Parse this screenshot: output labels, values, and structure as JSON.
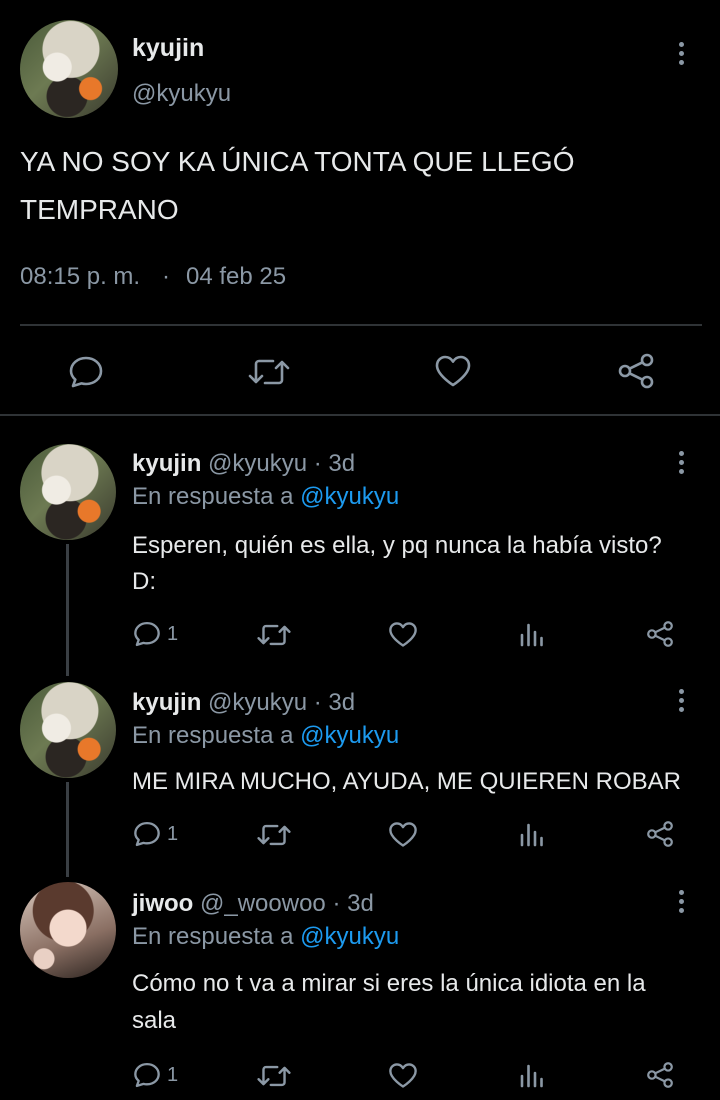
{
  "main_tweet": {
    "name": "kyujin",
    "handle": "@kyukyu",
    "text_line1": "YA NO SOY KA ÚNICA TONTA QUE LLEGÓ",
    "text_line2": "TEMPRANO",
    "time": "08:15 p. m.",
    "separator": "·",
    "date": "04 feb 25"
  },
  "replies": [
    {
      "name": "kyujin",
      "handle": "@kyukyu",
      "age": "· 3d",
      "reply_prefix": "En respuesta a",
      "reply_to": "@kyukyu",
      "text_line1": "Esperen, quién es ella, y pq nunca la había visto?",
      "text_line2": "D:",
      "reply_count": "1"
    },
    {
      "name": "kyujin",
      "handle": "@kyukyu",
      "age": "· 3d",
      "reply_prefix": "En respuesta a",
      "reply_to": "@kyukyu",
      "text_line1": "ME MIRA MUCHO, AYUDA, ME QUIEREN ROBAR",
      "text_line2": "",
      "reply_count": "1"
    },
    {
      "name": "jiwoo",
      "handle": "@_woowoo",
      "age": "· 3d",
      "reply_prefix": "En respuesta a",
      "reply_to": "@kyukyu",
      "text_line1": "Cómo no t va a mirar si eres la única idiota en la",
      "text_line2": "sala",
      "reply_count": "1"
    }
  ],
  "icons": {
    "reply": "reply-icon",
    "retweet": "retweet-icon",
    "like": "heart-icon",
    "views": "views-icon",
    "share": "share-icon",
    "more": "more-icon"
  },
  "colors": {
    "background": "#000000",
    "text": "#e7e9ea",
    "muted": "#8b98a5",
    "link": "#1d9bf0"
  }
}
